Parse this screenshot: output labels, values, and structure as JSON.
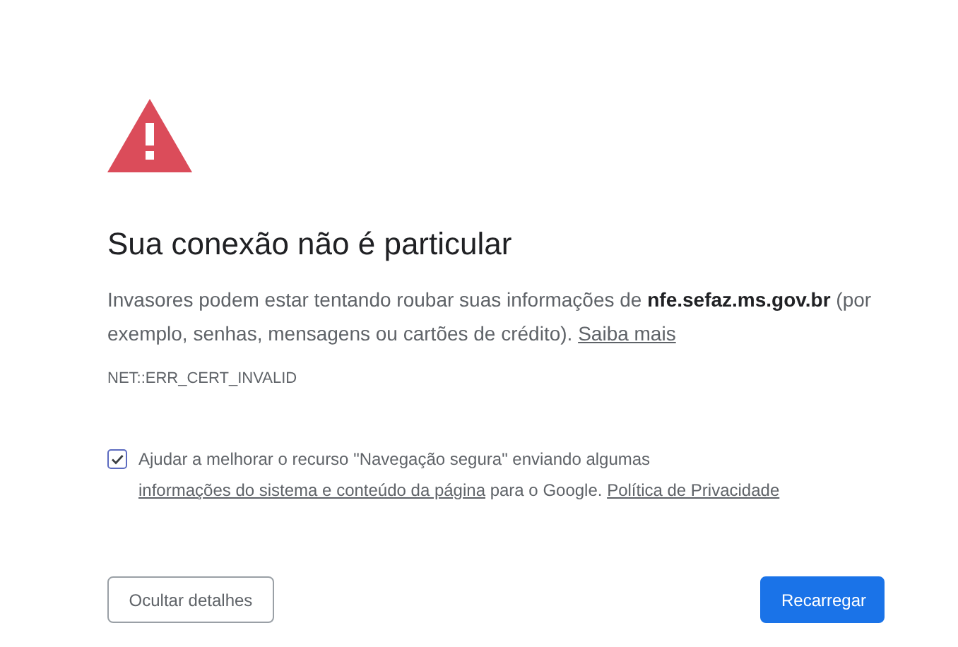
{
  "heading": "Sua conexão não é particular",
  "description": {
    "text": "Invasores podem estar tentando roubar suas informações de **nfe.sefaz.ms.gov.br** (por exemplo, senhas, mensagens ou cartões de crédito). ",
    "link": "Saiba mais"
  },
  "error_code": "NET::ERR_CERT_INVALID",
  "opt_in": {
    "checked": true,
    "text": "Ajudar a melhorar o recurso \"Navegação segura\" enviando algumas ",
    "link": "informações do sistema e conteúdo da página",
    "text_after": " para o Google. ",
    "privacy_link": "Política de Privacidade"
  },
  "buttons": [
    {
      "label": "Ocultar detalhes",
      "kind": "secondary"
    },
    {
      "label": "Recarregar",
      "kind": "primary"
    }
  ]
}
